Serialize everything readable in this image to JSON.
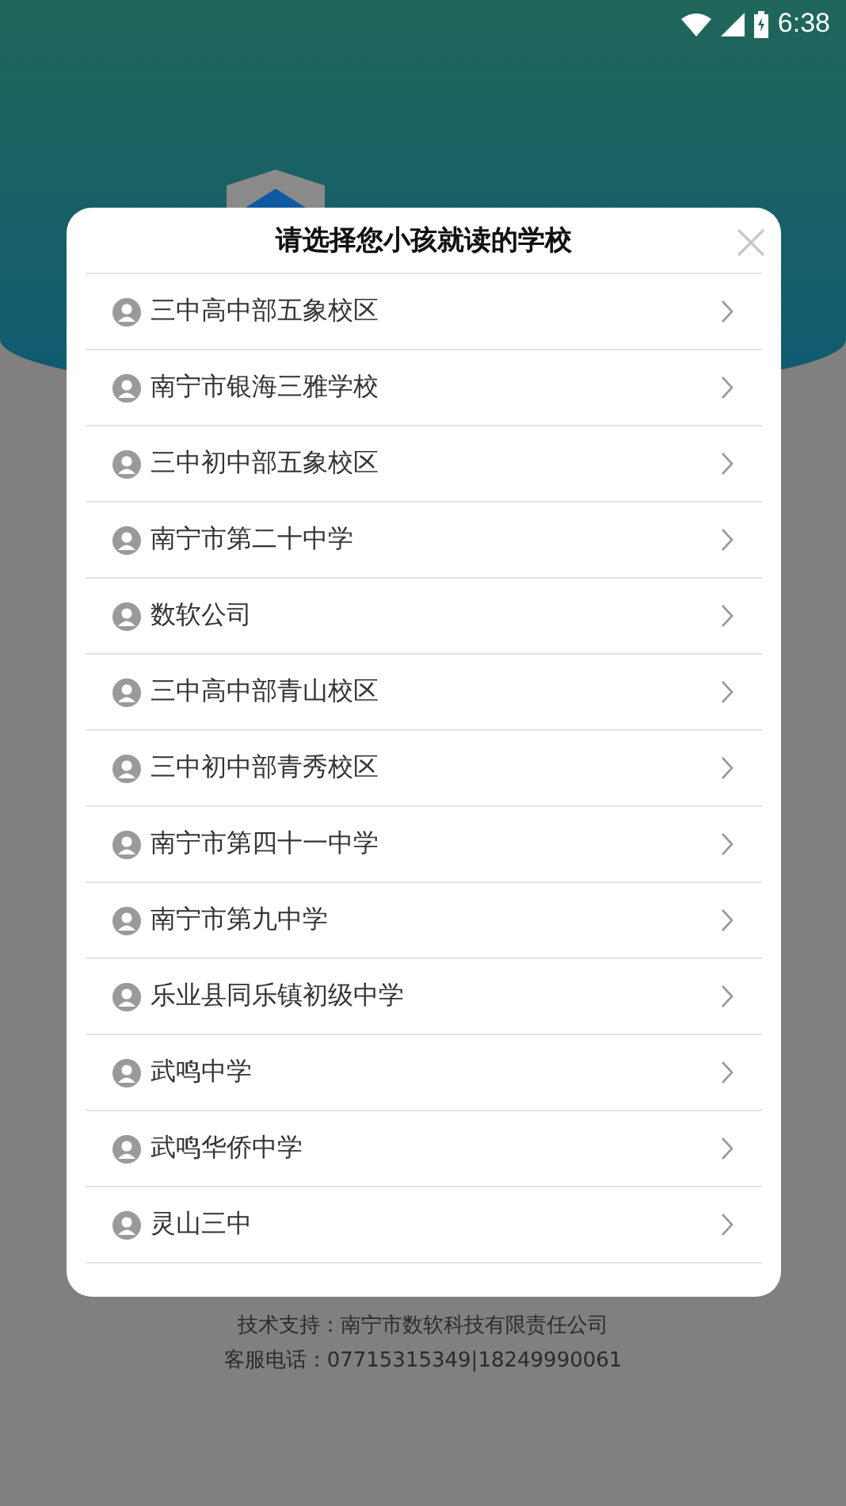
{
  "status_bar": {
    "time": "6:38"
  },
  "dialog": {
    "title": "请选择您小孩就读的学校",
    "schools": [
      "三中高中部五象校区",
      "南宁市银海三雅学校",
      "三中初中部五象校区",
      "南宁市第二十中学",
      "数软公司",
      "三中高中部青山校区",
      "三中初中部青秀校区",
      "南宁市第四十一中学",
      "南宁市第九中学",
      "乐业县同乐镇初级中学",
      "武鸣中学",
      "武鸣华侨中学",
      "灵山三中"
    ]
  },
  "footer": {
    "support": "技术支持：南宁市数软科技有限责任公司",
    "hotline": "客服电话：07715315349|18249990061"
  }
}
